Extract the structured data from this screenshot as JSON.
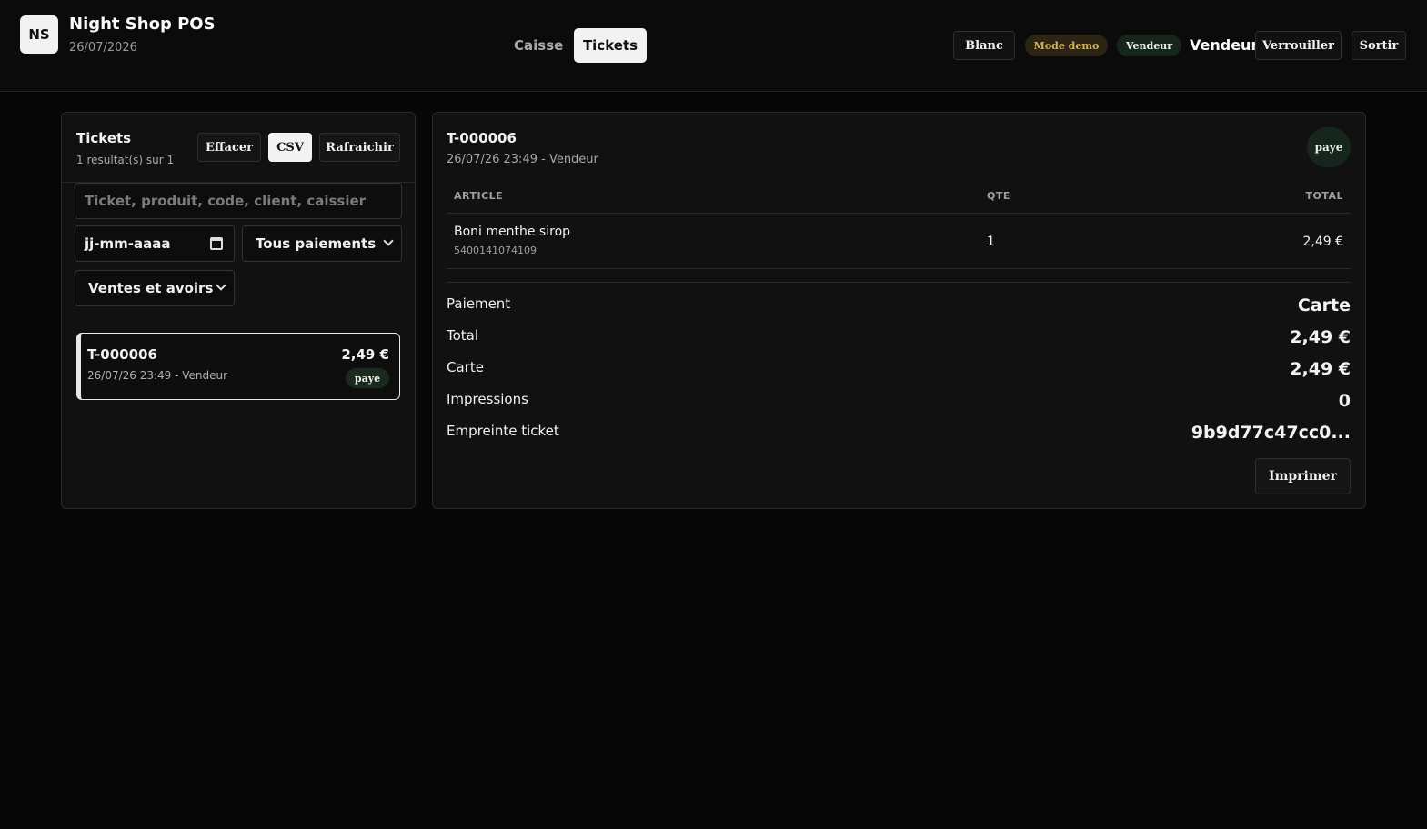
{
  "header": {
    "logo": "NS",
    "title": "Night Shop POS",
    "date": "26/07/2026",
    "tabs": [
      {
        "label": "Caisse",
        "active": false
      },
      {
        "label": "Tickets",
        "active": true
      }
    ],
    "blanc_label": "Blanc",
    "demo_badge": "Mode demo",
    "role_badge": "Vendeur",
    "user_name": "Vendeur",
    "lock_label": "Verrouiller",
    "exit_label": "Sortir"
  },
  "tickets_panel": {
    "title": "Tickets",
    "result_count": "1 resultat(s) sur 1",
    "clear_label": "Effacer",
    "csv_label": "CSV",
    "refresh_label": "Rafraichir",
    "search_placeholder": "Ticket, produit, code, client, caissier",
    "date_placeholder": "jj-mm-aaaa",
    "payment_filter": "Tous paiements",
    "type_filter": "Ventes et avoirs",
    "tickets": [
      {
        "id": "T-000006",
        "meta": "26/07/26 23:49 - Vendeur",
        "amount": "2,49 €",
        "status": "paye"
      }
    ]
  },
  "detail": {
    "id": "T-000006",
    "meta": "26/07/26 23:49 - Vendeur",
    "status": "paye",
    "columns": {
      "article": "ARTICLE",
      "qty": "QTE",
      "total": "TOTAL"
    },
    "items": [
      {
        "name": "Boni menthe sirop",
        "code": "5400141074109",
        "qty": "1",
        "total": "2,49 €"
      }
    ],
    "summary": [
      {
        "label": "Paiement",
        "value": "Carte"
      },
      {
        "label": "Total",
        "value": "2,49 €"
      },
      {
        "label": "Carte",
        "value": "2,49 €"
      },
      {
        "label": "Impressions",
        "value": "0"
      },
      {
        "label": "Empreinte ticket",
        "value": "9b9d77c47cc0..."
      }
    ],
    "print_label": "Imprimer"
  }
}
